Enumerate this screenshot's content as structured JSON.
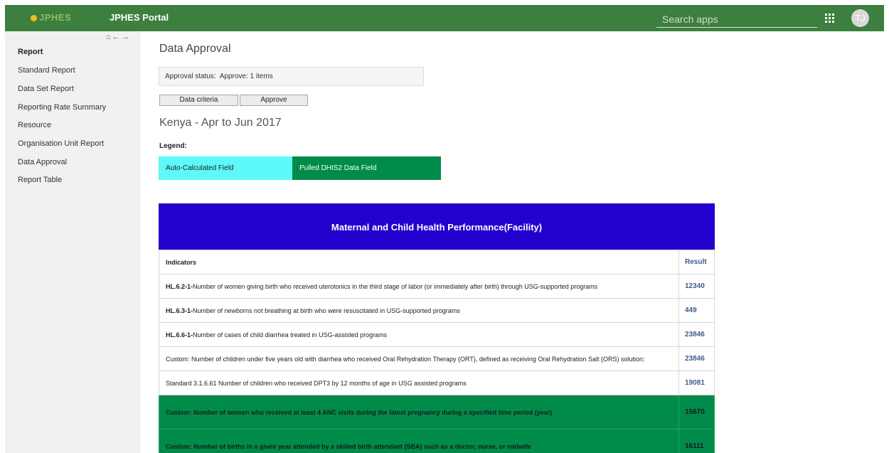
{
  "header": {
    "logo_text": "JPHES",
    "portal_title": "JPHES Portal",
    "search_placeholder": "Search apps",
    "avatar_initials": "TJ"
  },
  "sidebar": {
    "nav_icons": [
      "home-icon",
      "arrow-left-icon",
      "arrow-right-icon"
    ],
    "heading": "Report",
    "items": [
      {
        "label": "Standard Report"
      },
      {
        "label": "Data Set Report"
      },
      {
        "label": "Reporting Rate Summary"
      },
      {
        "label": "Resource"
      },
      {
        "label": "Organisation Unit Report"
      },
      {
        "label": "Data Approval"
      },
      {
        "label": "Report Table"
      }
    ]
  },
  "main": {
    "title": "Data Approval",
    "approval_status_label": "Approval status:",
    "approval_status_value": "Approve: 1 items",
    "buttons": {
      "criteria": "Data criteria",
      "approve": "Approve"
    },
    "period_title": "Kenya - Apr to Jun 2017",
    "legend_label": "Legend:",
    "legend": {
      "auto": "Auto-Calculated Field",
      "pulled": "Pulled DHIS2 Data Field"
    },
    "legend_colors": {
      "auto": "#5df8f8",
      "pulled": "#008b4b"
    }
  },
  "report": {
    "title": "Maternal and Child Health Performance(Facility)",
    "header_color": "#2400cf",
    "columns": {
      "indicator": "Indicators",
      "result": "Result"
    },
    "rows": [
      {
        "code": "HL.6.2-1-",
        "text": "Number of women giving birth who received uterotonics in the third stage of labor (or immediately after birth) through USG-supported programs",
        "result": "12340",
        "pulled": false
      },
      {
        "code": "HL.6.3-1-",
        "text": "Number of newborns not breathing at birth who were resuscitated in USG-supported programs",
        "result": "449",
        "pulled": false
      },
      {
        "code": "HL.6.6-1-",
        "text": "Number of cases of child diarrhea treated in USG-assisted programs",
        "result": "23846",
        "pulled": false
      },
      {
        "code": "",
        "text": "Custom: Number of children under five years old with diarrhea who received Oral Rehydration Therapy (ORT), defined as receiving Oral Rehydration Salt (ORS) solution:",
        "result": "23846",
        "pulled": false
      },
      {
        "code": "",
        "text": "Standard 3.1.6.61 Number of children who received DPT3 by 12 months of age in USG assisted programs",
        "result": "19081",
        "pulled": false
      },
      {
        "code": "",
        "text": "Custom: Number of women who received at least 4 ANC visits during the latest pregnancy during a specified time period (year)",
        "result": "15670",
        "pulled": true
      },
      {
        "code": "",
        "text": "Custom: Number of births in a given year attended by a skilled birth attendant (SBA) such as a doctor, nurse, or midwife",
        "result": "16111",
        "pulled": true
      }
    ]
  }
}
